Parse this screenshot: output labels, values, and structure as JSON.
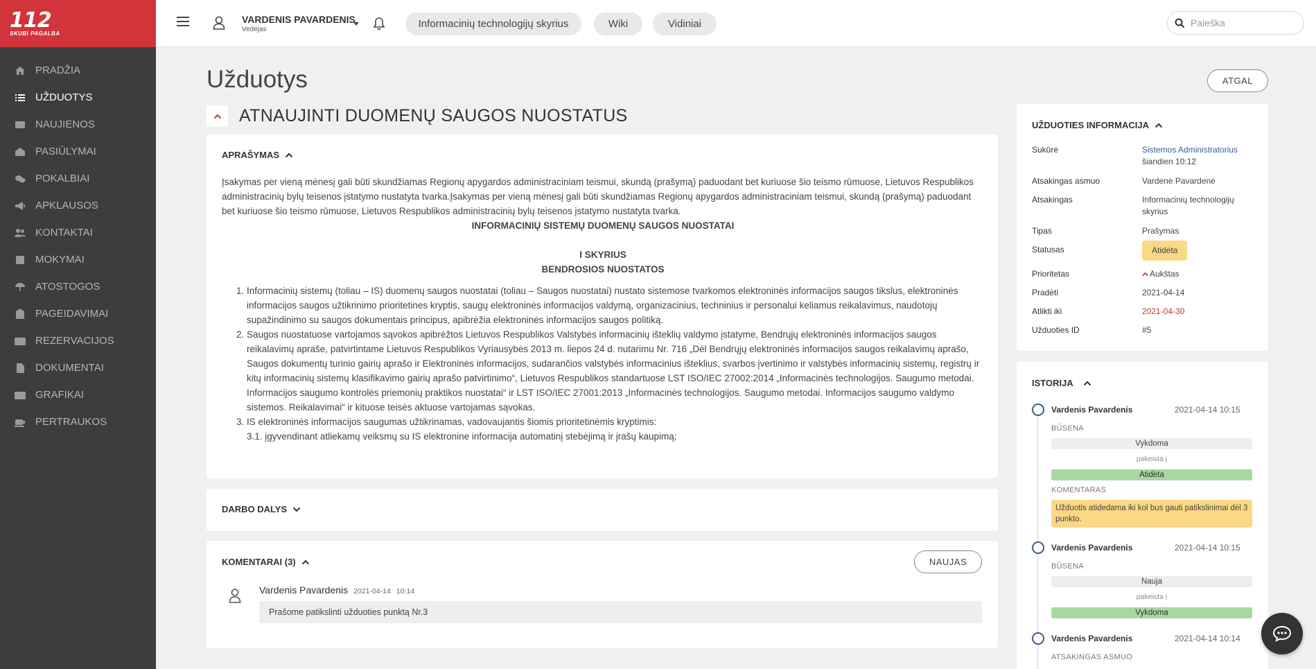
{
  "logo": {
    "number": "112",
    "tagline": "SKUBI PAGALBA"
  },
  "sidebar": {
    "items": [
      {
        "label": "Pradžia",
        "icon": "home-icon"
      },
      {
        "label": "Užduotys",
        "icon": "tasks-icon",
        "active": true
      },
      {
        "label": "Naujienos",
        "icon": "news-icon"
      },
      {
        "label": "Pasiūlymai",
        "icon": "suggestions-icon"
      },
      {
        "label": "Pokalbiai",
        "icon": "chat-icon"
      },
      {
        "label": "Apklausos",
        "icon": "megaphone-icon"
      },
      {
        "label": "Kontaktai",
        "icon": "contacts-icon"
      },
      {
        "label": "Mokymai",
        "icon": "book-icon"
      },
      {
        "label": "Atostogos",
        "icon": "umbrella-icon"
      },
      {
        "label": "Pageidavimai",
        "icon": "clipboard-icon"
      },
      {
        "label": "Rezervacijos",
        "icon": "id-card-icon"
      },
      {
        "label": "Dokumentai",
        "icon": "document-icon"
      },
      {
        "label": "Grafikai",
        "icon": "schedule-icon"
      },
      {
        "label": "Pertraukos",
        "icon": "coffee-icon"
      }
    ]
  },
  "topbar": {
    "user_name": "VARDENIS PAVARDENIS",
    "user_role": "Vedėjas",
    "pills": [
      "Informacinių technologijų skyrius",
      "Wiki",
      "Vidiniai"
    ],
    "search_placeholder": "Paieška"
  },
  "page": {
    "title": "Užduotys",
    "back_label": "ATGAL",
    "task_title": "ATNAUJINTI DUOMENŲ SAUGOS NUOSTATUS"
  },
  "description": {
    "heading": "APRAŠYMAS",
    "intro": "Įsakymas per vieną mėnesį gali būti skundžiamas Regionų apygardos administraciniam teismui, skundą (prašymą) paduodant bet kuriuose šio teismo rūmuose, Lietuvos Respublikos administracinių bylų teisenos įstatymo nustatyta tvarka.Įsakymas per vieną mėnesį gali būti skundžiamas Regionų apygardos administraciniam teismui, skundą (prašymą) paduodant bet kuriuose šio teismo rūmuose, Lietuvos Respublikos administracinių bylų teisenos įstatymo nustatyta tvarka.",
    "doc_title": "INFORMACINIŲ SISTEMŲ DUOMENŲ SAUGOS NUOSTATAI",
    "chapter": "I SKYRIUS",
    "chapter_title": "BENDROSIOS NUOSTATOS",
    "points": [
      "Informacinių sistemų  (toliau – IS) duomenų saugos nuostatai (toliau – Saugos nuostatai) nustato sistemose tvarkomos elektroninės informacijos saugos tikslus, elektroninės informacijos saugos užtikrinimo prioritetines kryptis, saugų elektroninės informacijos valdymą, organizacinius, techninius ir personalui keliamus reikalavimus, naudotojų supažindinimo su saugos dokumentais principus, apibrėžia elektroninės informacijos saugos politiką.",
      "Saugos nuostatuose vartojamos sąvokos apibrėžtos Lietuvos Respublikos Valstybės informacinių išteklių valdymo įstatyme, Bendrųjų elektroninės informacijos saugos reikalavimų apraše, patvirtintame Lietuvos Respublikos Vyriausybės 2013 m. liepos 24 d. nutarimu Nr. 716 „Dėl Bendrųjų elektroninės informacijos saugos reikalavimų aprašo, Saugos dokumentų turinio gairių aprašo ir Elektroninės informacijos, sudarančios valstybės informacinius išteklius, svarbos įvertinimo ir valstybės informacinių sistemų, registrų ir kitų informacinių sistemų klasifikavimo gairių aprašo patvirtinimo“, Lietuvos Respublikos standartuose LST ISO/IEC 27002:2014 „Informacinės technologijos. Saugumo metodai. Informacijos saugumo kontrolės priemonių praktikos nuostatai“ ir LST ISO/IEC 27001:2013 „Informacinės technologijos. Saugumo metodai. Informacijos saugumo valdymo sistemos. Reikalavimai“ ir kituose teisės aktuose vartojamas sąvokas.",
      " IS elektroninės informacijos saugumas užtikrinamas, vadovaujantis šiomis prioritetinėmis kryptimis:"
    ],
    "subpoint": "3.1. įgyvendinant atliekamų veiksmų su IS elektronine informacija automatinį stebėjimą ir įrašų kaupimą;"
  },
  "work_parts": {
    "heading": "DARBO DALYS"
  },
  "comments": {
    "heading": "KOMENTARAI (3)",
    "new_label": "NAUJAS",
    "items": [
      {
        "author": "Vardenis Pavardenis",
        "date": "2021-04-14",
        "time": "10:14",
        "text": "Prašome patikslinti užduoties punktą Nr.3"
      }
    ]
  },
  "task_info": {
    "heading": "UŽDUOTIES INFORMACIJA",
    "created_label": "Sukūrė",
    "created_by": "Sistemos Administratorius",
    "created_when": "šiandien 10:12",
    "responsible_person_label": "Atsakingas asmuo",
    "responsible_person": "Vardenė Pavardenė",
    "responsible_label": "Atsakingas",
    "responsible": "Informacinių technologijų skyrius",
    "type_label": "Tipas",
    "type": "Prašymas",
    "status_label": "Statusas",
    "status": "Atidėta",
    "priority_label": "Prioritetas",
    "priority": "Aukštas",
    "start_label": "Pradėti",
    "start": "2021-04-14",
    "due_label": "Atlikti iki",
    "due": "2021-04-30",
    "id_label": "Užduoties ID",
    "id": "#5"
  },
  "history": {
    "heading": "ISTORIJA",
    "entries": [
      {
        "author": "Vardenis Pavardenis",
        "datetime": "2021-04-14 10:15",
        "label": "BŪSENA",
        "from": "Vykdoma",
        "changed": "pakeista į",
        "to": "Atidėta",
        "comment_label": "KOMENTARAS",
        "comment": "Užduotis atidedama iki kol bus gauti patikslinimai dėl 3 punkto."
      },
      {
        "author": "Vardenis Pavardenis",
        "datetime": "2021-04-14 10:15",
        "label": "BŪSENA",
        "from": "Nauja",
        "changed": "pakeista į",
        "to": "Vykdoma"
      },
      {
        "author": "Vardenis Pavardenis",
        "datetime": "2021-04-14 10:14",
        "label": "ATSAKINGAS ASMUO"
      }
    ]
  },
  "colors": {
    "brand_red": "#d1343a",
    "sidebar_bg": "#3d3d3d",
    "link_blue": "#3b5a9a",
    "due_red": "#c0392b",
    "status_yellow": "#fbd884",
    "status_green": "#a6d89f",
    "timeline_blue": "#3f5a8c"
  }
}
